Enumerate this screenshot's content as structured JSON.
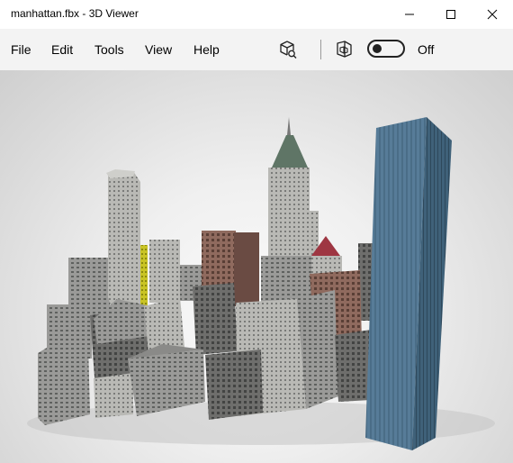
{
  "window": {
    "title": "manhattan.fbx - 3D Viewer"
  },
  "menu": {
    "items": [
      "File",
      "Edit",
      "Tools",
      "View",
      "Help"
    ]
  },
  "toolbar": {
    "toggle_label": "Off",
    "toggle_state": "off",
    "icons": [
      "3d-object-select-icon",
      "environment-view-icon"
    ]
  },
  "viewport": {
    "model": "manhattan.fbx"
  }
}
